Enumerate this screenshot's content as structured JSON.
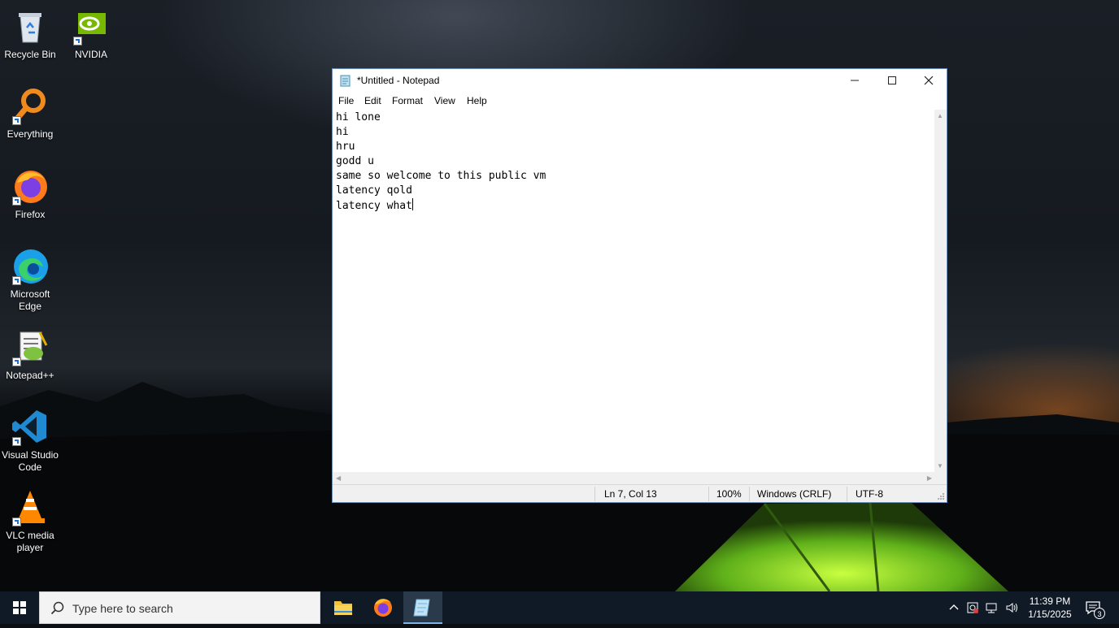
{
  "desktop_icons": [
    {
      "label": "Recycle Bin",
      "icon": "recycle-bin-icon"
    },
    {
      "label": "NVIDIA",
      "icon": "nvidia-icon"
    },
    {
      "label": "Everything",
      "icon": "everything-search-icon"
    },
    {
      "label": "Firefox",
      "icon": "firefox-icon"
    },
    {
      "label": "Microsoft Edge",
      "icon": "edge-icon"
    },
    {
      "label": "Notepad++",
      "icon": "notepad-plus-plus-icon"
    },
    {
      "label": "Visual Studio Code",
      "icon": "vscode-icon"
    },
    {
      "label": "VLC media player",
      "icon": "vlc-icon"
    }
  ],
  "notepad": {
    "title": "*Untitled - Notepad",
    "menu": [
      "File",
      "Edit",
      "Format",
      "View",
      "Help"
    ],
    "lines": [
      "hi lone",
      "hi",
      "hru",
      "godd u",
      "same so welcome to this public vm",
      "latency qold",
      "latency what"
    ],
    "status": {
      "position": "Ln 7, Col 13",
      "zoom": "100%",
      "line_ending": "Windows (CRLF)",
      "encoding": "UTF-8"
    }
  },
  "taskbar": {
    "search_placeholder": "Type here to search",
    "apps": [
      "file-explorer-icon",
      "firefox-icon",
      "notepad-icon"
    ],
    "time": "11:39 PM",
    "date": "1/15/2025",
    "notification_count": "3"
  },
  "colors": {
    "taskbar_bg": "#101a26",
    "window_border": "#6e8fb5",
    "accent": "#7fb3e6"
  }
}
